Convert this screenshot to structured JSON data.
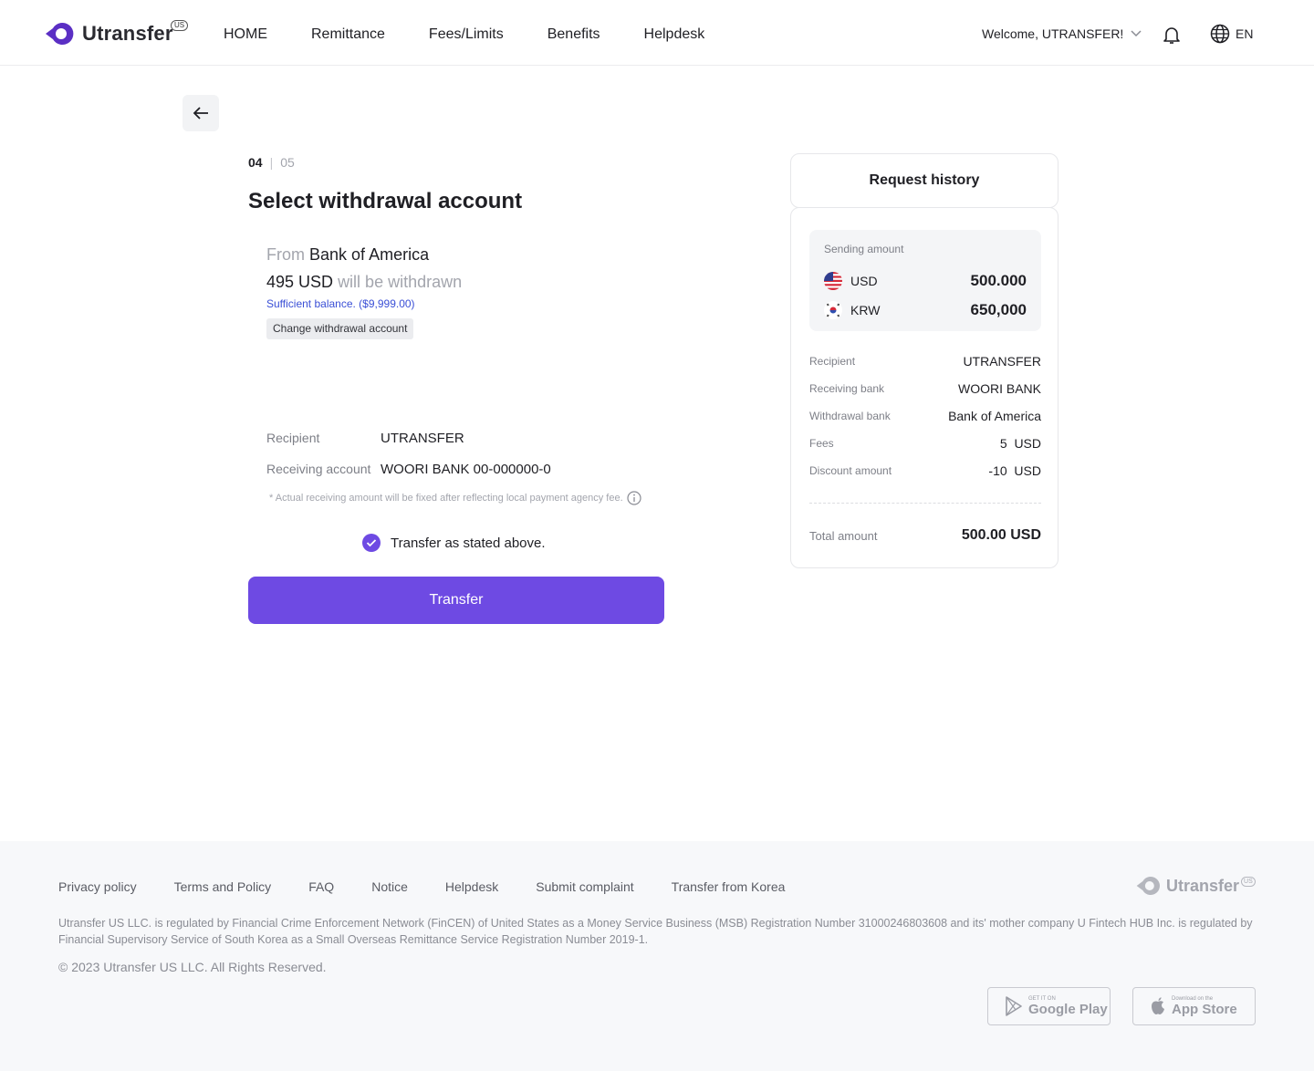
{
  "header": {
    "logo_text": "Utransfer",
    "logo_badge": "US",
    "nav": [
      "HOME",
      "Remittance",
      "Fees/Limits",
      "Benefits",
      "Helpdesk"
    ],
    "welcome": "Welcome, UTRANSFER!",
    "language": "EN"
  },
  "step": {
    "current": "04",
    "total": "05"
  },
  "page_title": "Select withdrawal account",
  "withdrawal": {
    "from_prefix": "From",
    "bank": "Bank of America",
    "amount": "495 USD",
    "amount_suffix": "will be withdrawn",
    "balance_note": "Sufficient balance. ($9,999.00)",
    "change_label": "Change withdrawal account"
  },
  "details": {
    "recipient_label": "Recipient",
    "recipient_value": "UTRANSFER",
    "account_label": "Receiving account",
    "account_value": "WOORI BANK 00-000000-0",
    "note": "* Actual receiving amount will be fixed after reflecting local payment agency fee."
  },
  "agree_label": "Transfer as stated above.",
  "transfer_label": "Transfer",
  "history": {
    "title": "Request history",
    "sending_label": "Sending amount",
    "currencies": [
      {
        "code": "USD",
        "amount": "500.000"
      },
      {
        "code": "KRW",
        "amount": "650,000"
      }
    ],
    "rows": [
      {
        "label": "Recipient",
        "value": "UTRANSFER"
      },
      {
        "label": "Receiving bank",
        "value": "WOORI BANK"
      },
      {
        "label": "Withdrawal bank",
        "value": "Bank of America"
      },
      {
        "label": "Fees",
        "value": "5  USD"
      },
      {
        "label": "Discount amount",
        "value": "-10  USD"
      }
    ],
    "total_label": "Total amount",
    "total_value": "500.00 USD"
  },
  "footer": {
    "links": [
      "Privacy policy",
      "Terms and Policy",
      "FAQ",
      "Notice",
      "Helpdesk",
      "Submit complaint",
      "Transfer from Korea"
    ],
    "logo_text": "Utransfer",
    "logo_badge": "US",
    "regulation": "Utransfer US LLC. is regulated by Financial Crime Enforcement Network (FinCEN) of United States as a Money Service Business (MSB) Registration Number 31000246803608 and its' mother company U Fintech HUB Inc. is regulated by Financial Supervisory Service of South Korea as a Small Overseas Remittance Service Registration Number 2019-1.",
    "copyright": "© 2023 Utransfer US LLC. All Rights Reserved.",
    "google_small": "GET IT ON",
    "google_big": "Google Play",
    "apple_small": "Download on the",
    "apple_big": "App Store"
  },
  "colors": {
    "accent": "#6e4ae3",
    "balance": "#3a4fd6"
  }
}
